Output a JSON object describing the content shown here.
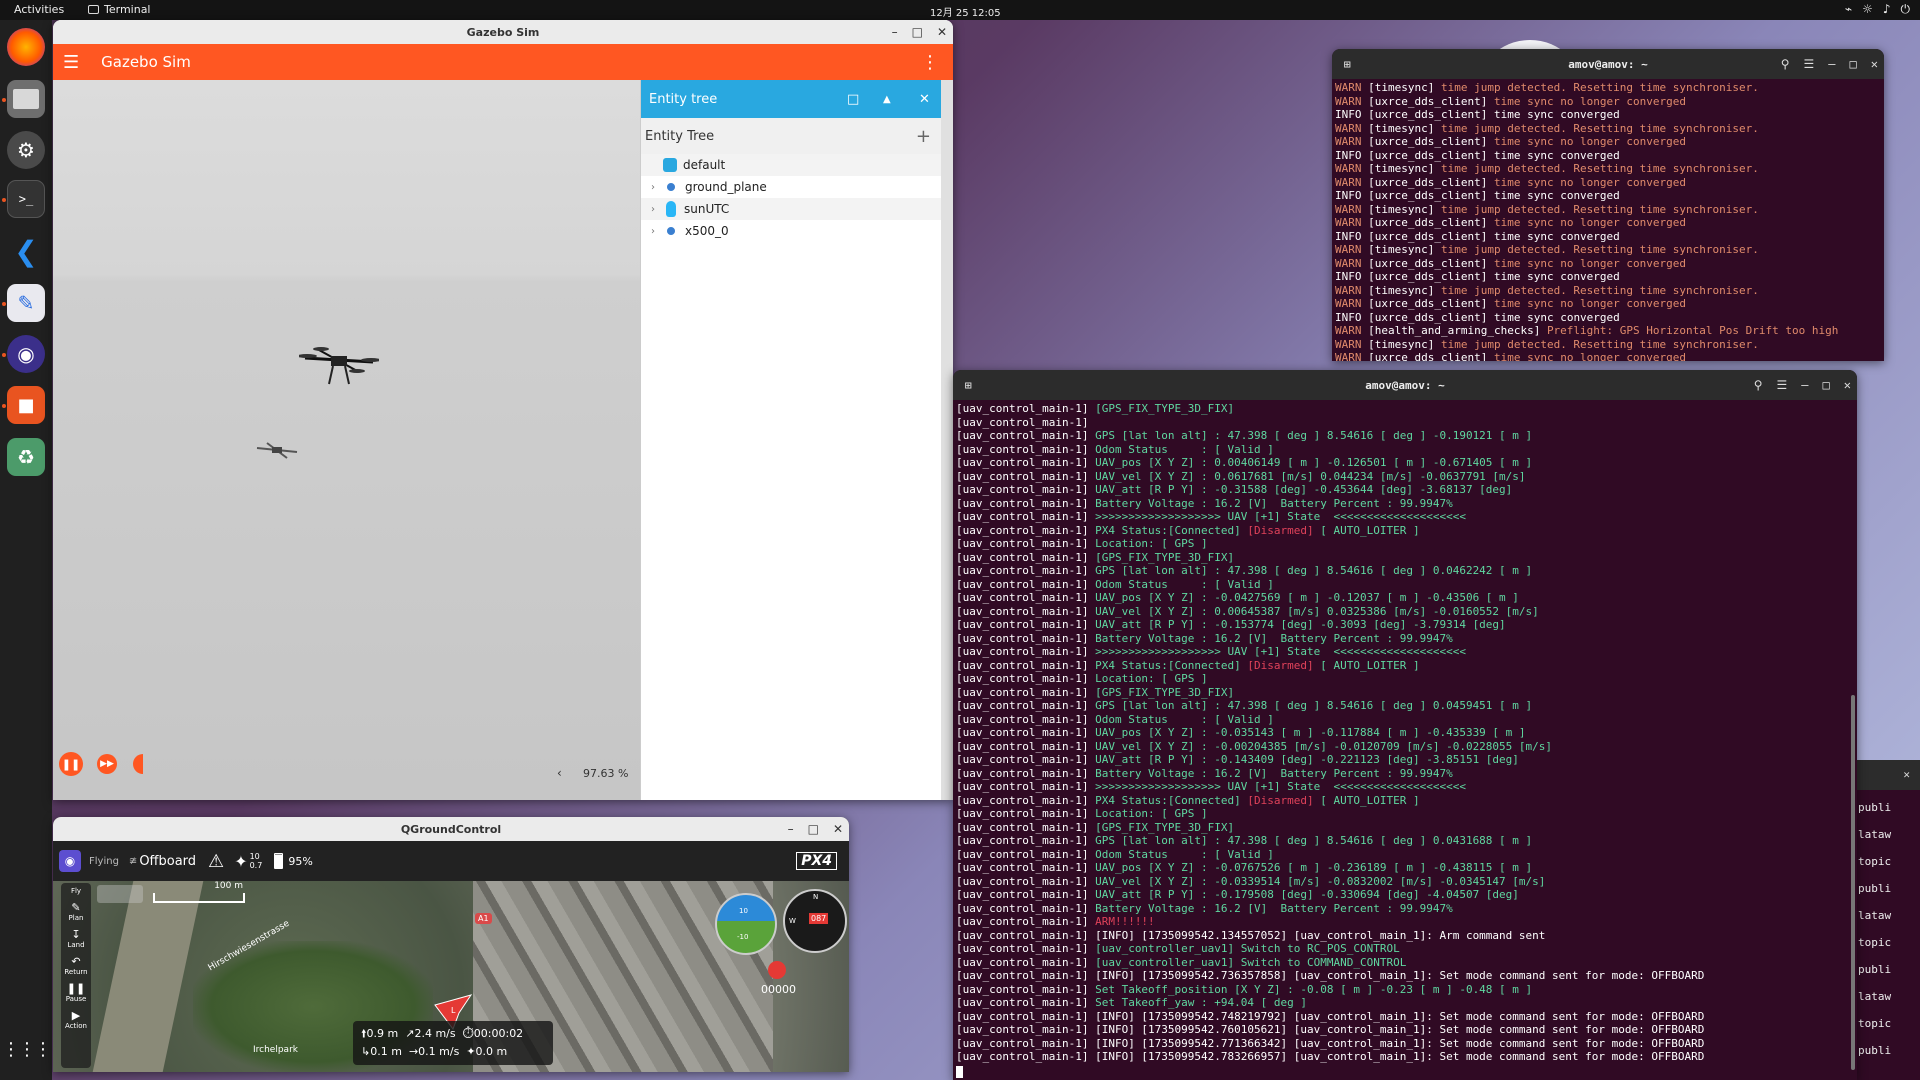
{
  "topbar": {
    "activities": "Activities",
    "app": "Terminal",
    "clock": "12月 25  12:05"
  },
  "dock": {
    "items": [
      "firefox-icon",
      "files-icon",
      "settings-icon",
      "terminal-icon",
      "vscode-icon",
      "text-editor-icon",
      "qgroundcontrol-icon",
      "software-icon",
      "trash-icon",
      "apps-grid-icon"
    ]
  },
  "gazebo": {
    "window_title": "Gazebo Sim",
    "app_title": "Gazebo Sim",
    "entity_panel_title": "Entity tree",
    "entity_tree_label": "Entity Tree",
    "entities": [
      {
        "name": "default",
        "color": "#29a8e0",
        "expandable": false
      },
      {
        "name": "ground_plane",
        "color": "#3a7fd0",
        "expandable": true
      },
      {
        "name": "sunUTC",
        "color": "#29b6f6",
        "expandable": true
      },
      {
        "name": "x500_0",
        "color": "#3a7fd0",
        "expandable": true
      }
    ],
    "rtf": "97.63 %",
    "colors": {
      "appbar": "#ff5722",
      "panel": "#29a8e0"
    }
  },
  "qgc": {
    "window_title": "QGroundControl",
    "flight_state": "Flying",
    "mode": "Offboard",
    "gps_sats": "10",
    "gps_hdop": "0.7",
    "battery": "95%",
    "brand": "PX4",
    "scale": "100 m",
    "tools": [
      "Fly",
      "Plan",
      "Land",
      "Return",
      "Pause",
      "Action"
    ],
    "map_labels": [
      "Hirschwiesenstrasse",
      "Irchelpark"
    ],
    "road_badge": "A1",
    "heading": "087",
    "compass_n": "N",
    "compass_w": "W",
    "pitch_up": "10",
    "pitch_down": "-10",
    "timer": "00000",
    "telemetry": {
      "alt": "0.9 m",
      "hspeed": "2.4 m/s",
      "time": "00:00:02",
      "dist": "0.1 m",
      "vspeed": "0.1 m/s",
      "home": "0.0 m"
    }
  },
  "term1": {
    "title": "amov@amov: ~",
    "lines": [
      [
        "WARN",
        "[timesync]",
        "time jump detected. Resetting time synchroniser."
      ],
      [
        "WARN",
        "[uxrce_dds_client]",
        "time sync no longer converged"
      ],
      [
        "INFO",
        "[uxrce_dds_client]",
        "time sync converged"
      ],
      [
        "WARN",
        "[timesync]",
        "time jump detected. Resetting time synchroniser."
      ],
      [
        "WARN",
        "[uxrce_dds_client]",
        "time sync no longer converged"
      ],
      [
        "INFO",
        "[uxrce_dds_client]",
        "time sync converged"
      ],
      [
        "WARN",
        "[timesync]",
        "time jump detected. Resetting time synchroniser."
      ],
      [
        "WARN",
        "[uxrce_dds_client]",
        "time sync no longer converged"
      ],
      [
        "INFO",
        "[uxrce_dds_client]",
        "time sync converged"
      ],
      [
        "WARN",
        "[timesync]",
        "time jump detected. Resetting time synchroniser."
      ],
      [
        "WARN",
        "[uxrce_dds_client]",
        "time sync no longer converged"
      ],
      [
        "INFO",
        "[uxrce_dds_client]",
        "time sync converged"
      ],
      [
        "WARN",
        "[timesync]",
        "time jump detected. Resetting time synchroniser."
      ],
      [
        "WARN",
        "[uxrce_dds_client]",
        "time sync no longer converged"
      ],
      [
        "INFO",
        "[uxrce_dds_client]",
        "time sync converged"
      ],
      [
        "WARN",
        "[timesync]",
        "time jump detected. Resetting time synchroniser."
      ],
      [
        "WARN",
        "[uxrce_dds_client]",
        "time sync no longer converged"
      ],
      [
        "INFO",
        "[uxrce_dds_client]",
        "time sync converged"
      ],
      [
        "WARN",
        "[health_and_arming_checks]",
        "Preflight: GPS Horizontal Pos Drift too high"
      ],
      [
        "WARN",
        "[timesync]",
        "time jump detected. Resetting time synchroniser."
      ],
      [
        "WARN",
        "[uxrce_dds_client]",
        "time sync no longer converged"
      ]
    ]
  },
  "term2": {
    "title": "amov@amov: ~",
    "lines": [
      [
        "g",
        "[GPS_FIX_TYPE_3D_FIX]"
      ],
      [
        "w",
        ""
      ],
      [
        "g",
        "GPS [lat lon alt] : 47.398 [ deg ] 8.54616 [ deg ] -0.190121 [ m ]"
      ],
      [
        "g",
        "Odom Status     : [ Valid ]"
      ],
      [
        "g",
        "UAV_pos [X Y Z] : 0.00406149 [ m ] -0.126501 [ m ] -0.671405 [ m ]"
      ],
      [
        "g",
        "UAV_vel [X Y Z] : 0.0617681 [m/s] 0.044234 [m/s] -0.0637791 [m/s]"
      ],
      [
        "g",
        "UAV_att [R P Y] : -0.31588 [deg] -0.453644 [deg] -3.68137 [deg]"
      ],
      [
        "g",
        "Battery Voltage : 16.2 [V]  Battery Percent : 99.9947%"
      ],
      [
        "g",
        ">>>>>>>>>>>>>>>>>>> UAV [+1] State  <<<<<<<<<<<<<<<<<<<<"
      ],
      [
        "pr",
        "PX4 Status:[Connected] ",
        "[Disarmed]",
        " [ AUTO_LOITER ]"
      ],
      [
        "g",
        "Location: [ GPS ]"
      ],
      [
        "g",
        "[GPS_FIX_TYPE_3D_FIX]"
      ],
      [
        "g",
        "GPS [lat lon alt] : 47.398 [ deg ] 8.54616 [ deg ] 0.0462242 [ m ]"
      ],
      [
        "g",
        "Odom Status     : [ Valid ]"
      ],
      [
        "g",
        "UAV_pos [X Y Z] : -0.0427569 [ m ] -0.12037 [ m ] -0.43506 [ m ]"
      ],
      [
        "g",
        "UAV_vel [X Y Z] : 0.00645387 [m/s] 0.0325386 [m/s] -0.0160552 [m/s]"
      ],
      [
        "g",
        "UAV_att [R P Y] : -0.153774 [deg] -0.3093 [deg] -3.79314 [deg]"
      ],
      [
        "g",
        "Battery Voltage : 16.2 [V]  Battery Percent : 99.9947%"
      ],
      [
        "g",
        ">>>>>>>>>>>>>>>>>>> UAV [+1] State  <<<<<<<<<<<<<<<<<<<<"
      ],
      [
        "pr",
        "PX4 Status:[Connected] ",
        "[Disarmed]",
        " [ AUTO_LOITER ]"
      ],
      [
        "g",
        "Location: [ GPS ]"
      ],
      [
        "g",
        "[GPS_FIX_TYPE_3D_FIX]"
      ],
      [
        "g",
        "GPS [lat lon alt] : 47.398 [ deg ] 8.54616 [ deg ] 0.0459451 [ m ]"
      ],
      [
        "g",
        "Odom Status     : [ Valid ]"
      ],
      [
        "g",
        "UAV_pos [X Y Z] : -0.035143 [ m ] -0.117884 [ m ] -0.435339 [ m ]"
      ],
      [
        "g",
        "UAV_vel [X Y Z] : -0.00204385 [m/s] -0.0120709 [m/s] -0.0228055 [m/s]"
      ],
      [
        "g",
        "UAV_att [R P Y] : -0.143409 [deg] -0.221123 [deg] -3.85151 [deg]"
      ],
      [
        "g",
        "Battery Voltage : 16.2 [V]  Battery Percent : 99.9947%"
      ],
      [
        "g",
        ">>>>>>>>>>>>>>>>>>> UAV [+1] State  <<<<<<<<<<<<<<<<<<<<"
      ],
      [
        "pr",
        "PX4 Status:[Connected] ",
        "[Disarmed]",
        " [ AUTO_LOITER ]"
      ],
      [
        "g",
        "Location: [ GPS ]"
      ],
      [
        "g",
        "[GPS_FIX_TYPE_3D_FIX]"
      ],
      [
        "g",
        "GPS [lat lon alt] : 47.398 [ deg ] 8.54616 [ deg ] 0.0431688 [ m ]"
      ],
      [
        "g",
        "Odom Status     : [ Valid ]"
      ],
      [
        "g",
        "UAV_pos [X Y Z] : -0.0767526 [ m ] -0.236189 [ m ] -0.438115 [ m ]"
      ],
      [
        "g",
        "UAV_vel [X Y Z] : -0.0339514 [m/s] -0.0832002 [m/s] -0.0345147 [m/s]"
      ],
      [
        "g",
        "UAV_att [R P Y] : -0.179508 [deg] -0.330694 [deg] -4.04507 [deg]"
      ],
      [
        "g",
        "Battery Voltage : 16.2 [V]  Battery Percent : 99.9947%"
      ],
      [
        "r",
        "ARM!!!!!!"
      ],
      [
        "w",
        "[INFO] [1735099542.134557052] [uav_control_main_1]: Arm command sent"
      ],
      [
        "g",
        "[uav_controller_uav1] Switch to RC_POS_CONTROL"
      ],
      [
        "g",
        "[uav_controller_uav1] Switch to COMMAND_CONTROL"
      ],
      [
        "w",
        "[INFO] [1735099542.736357858] [uav_control_main_1]: Set mode command sent for mode: OFFBOARD"
      ],
      [
        "g",
        "Set Takeoff_position [X Y Z] : -0.08 [ m ] -0.23 [ m ] -0.48 [ m ]"
      ],
      [
        "g",
        "Set Takeoff_yaw : +94.04 [ deg ]"
      ],
      [
        "w",
        "[INFO] [1735099542.748219792] [uav_control_main_1]: Set mode command sent for mode: OFFBOARD"
      ],
      [
        "w",
        "[INFO] [1735099542.760105621] [uav_control_main_1]: Set mode command sent for mode: OFFBOARD"
      ],
      [
        "w",
        "[INFO] [1735099542.771366342] [uav_control_main_1]: Set mode command sent for mode: OFFBOARD"
      ],
      [
        "w",
        "[INFO] [1735099542.783266957] [uav_control_main_1]: Set mode command sent for mode: OFFBOARD"
      ]
    ],
    "prefix": "[uav_control_main-1] "
  },
  "term3": {
    "lines": [
      "publi",
      "lataw",
      "topic",
      "publi",
      "lataw",
      "topic",
      "publi",
      "lataw",
      "topic",
      "publi"
    ]
  }
}
